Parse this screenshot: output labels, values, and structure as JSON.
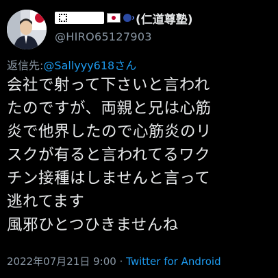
{
  "author": {
    "name_suffix": "(仁道尊塾)",
    "handle": "@HIRO65127903",
    "avatar_icon": "profile-photo-icon",
    "flag_icon": "japan-flag-icon",
    "speaker_icon": "speaking-head-icon"
  },
  "reply": {
    "label": "返信先:",
    "user": "@Sallyyy618",
    "suffix": "さん"
  },
  "body_lines": [
    "会社で射って下さいと言われ",
    "たのですが、両親と兄は心筋",
    "炎で他界したので心筋炎のリ",
    "スクが有ると言われてるワク",
    "チン接種はしませんと言って",
    "逃れてます",
    "風邪ひとつひきませんね"
  ],
  "meta": {
    "date": "2022年07月21日 9:00",
    "separator": "·",
    "source": "Twitter for Android"
  },
  "colors": {
    "background": "#000000",
    "text": "#e7e9ea",
    "muted": "#8b98a5",
    "link": "#1d9bf0"
  }
}
